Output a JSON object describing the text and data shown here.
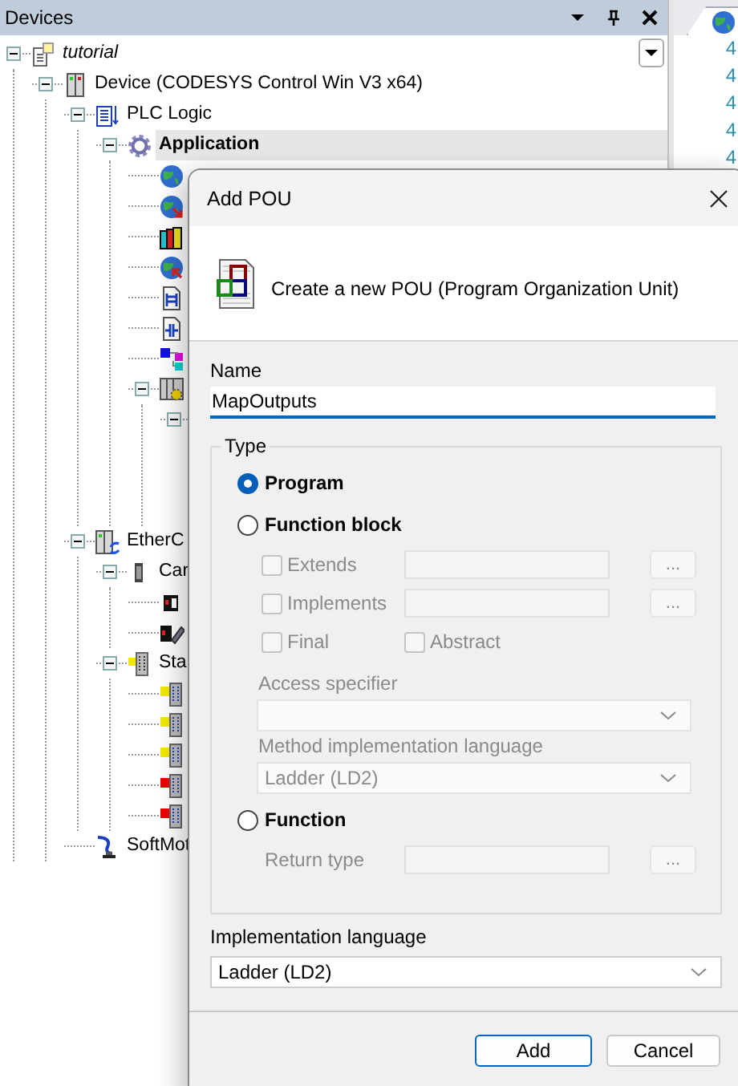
{
  "devices_panel": {
    "title": "Devices",
    "tree": [
      {
        "label": "tutorial",
        "kind": "project",
        "expanded": true,
        "selected": false,
        "children": [
          {
            "label": "Device (CODESYS Control Win V3 x64)",
            "kind": "device",
            "expanded": true,
            "selected": false,
            "children": [
              {
                "label": "PLC Logic",
                "kind": "plc-logic",
                "expanded": true,
                "selected": false,
                "children": [
                  {
                    "label": "Application",
                    "kind": "application",
                    "active": true,
                    "expanded": true,
                    "selected": true,
                    "children": [
                      {
                        "kind": "globe",
                        "selected": false
                      },
                      {
                        "kind": "globe-in",
                        "selected": false
                      },
                      {
                        "kind": "library",
                        "selected": false
                      },
                      {
                        "kind": "globe-out",
                        "selected": false
                      },
                      {
                        "kind": "ladder-doc",
                        "selected": false
                      },
                      {
                        "kind": "contact-doc",
                        "selected": false
                      },
                      {
                        "kind": "task-config",
                        "selected": false
                      },
                      {
                        "kind": "module-gear",
                        "expanded": true,
                        "selected": false,
                        "children": [
                          {
                            "expanded": true
                          }
                        ]
                      }
                    ]
                  }
                ]
              },
              {
                "label": "EtherC",
                "kind": "ethercat-master",
                "expanded": true,
                "selected": false,
                "children": [
                  {
                    "label": "Car",
                    "kind": "coupler",
                    "expanded": true,
                    "selected": false,
                    "children": [
                      {
                        "kind": "drive",
                        "selected": false
                      },
                      {
                        "kind": "drive-axis",
                        "selected": false
                      }
                    ]
                  },
                  {
                    "label": "Sta",
                    "kind": "io-rack",
                    "expanded": true,
                    "selected": false,
                    "children": [
                      {
                        "kind": "io-module",
                        "color": "#f0e800",
                        "selected": false
                      },
                      {
                        "kind": "io-module",
                        "color": "#f0e800",
                        "selected": false
                      },
                      {
                        "kind": "io-module",
                        "color": "#f0e800",
                        "selected": false
                      },
                      {
                        "kind": "io-module",
                        "color": "#f00000",
                        "selected": false
                      },
                      {
                        "kind": "io-module",
                        "color": "#f00000",
                        "selected": false
                      }
                    ]
                  }
                ]
              },
              {
                "label": "SoftMot",
                "kind": "softmotion",
                "selected": false
              }
            ]
          }
        ]
      }
    ]
  },
  "editor": {
    "line_numbers": [
      "4",
      "4",
      "4",
      "4",
      "4"
    ]
  },
  "dialog": {
    "title": "Add POU",
    "description": "Create a new POU (Program Organization Unit)",
    "name": {
      "label": "Name",
      "value": "MapOutputs"
    },
    "type_group": {
      "legend": "Type",
      "items": [
        {
          "kind": "radio",
          "label": "Program",
          "selected": true
        },
        {
          "kind": "radio",
          "label": "Function block",
          "selected": false
        },
        {
          "kind": "checkbox-field",
          "label": "Extends",
          "checked": false,
          "disabled": true,
          "button": "..."
        },
        {
          "kind": "checkbox-field",
          "label": "Implements",
          "checked": false,
          "disabled": true,
          "button": "..."
        },
        {
          "kind": "checkbox-pair",
          "items": [
            {
              "label": "Final",
              "checked": false,
              "disabled": true
            },
            {
              "label": "Abstract",
              "checked": false,
              "disabled": true
            }
          ]
        },
        {
          "kind": "combo",
          "label": "Access specifier",
          "disabled": true
        },
        {
          "kind": "combo",
          "label": "Method implementation language",
          "value": "Ladder (LD2)",
          "disabled": true
        },
        {
          "kind": "radio",
          "label": "Function",
          "selected": false
        },
        {
          "kind": "field",
          "label": "Return type",
          "disabled": true,
          "button": "..."
        }
      ]
    },
    "implementation_language": {
      "label": "Implementation language",
      "value": "Ladder (LD2)"
    },
    "buttons": [
      {
        "label": "Add",
        "default": true
      },
      {
        "label": "Cancel",
        "default": false
      }
    ]
  }
}
